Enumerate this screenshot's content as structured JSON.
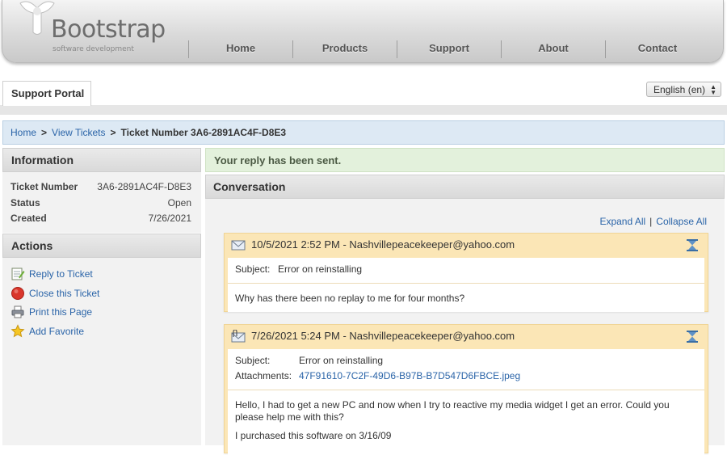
{
  "brand": {
    "name": "Bootstrap",
    "tagline": "software development"
  },
  "nav": [
    "Home",
    "Products",
    "Support",
    "About",
    "Contact"
  ],
  "portal": {
    "tab_label": "Support Portal",
    "language": "English (en)"
  },
  "breadcrumb": {
    "home": "Home",
    "view_tickets": "View Tickets",
    "current": "Ticket Number 3A6-2891AC4F-D8E3"
  },
  "information": {
    "title": "Information",
    "rows": [
      {
        "label": "Ticket Number",
        "value": "3A6-2891AC4F-D8E3"
      },
      {
        "label": "Status",
        "value": "Open"
      },
      {
        "label": "Created",
        "value": "7/26/2021"
      }
    ]
  },
  "actions": {
    "title": "Actions",
    "items": [
      {
        "label": "Reply to Ticket",
        "icon": "note-edit-icon"
      },
      {
        "label": "Close this Ticket",
        "icon": "red-circle-icon"
      },
      {
        "label": "Print this Page",
        "icon": "printer-icon"
      },
      {
        "label": "Add Favorite",
        "icon": "star-icon"
      }
    ]
  },
  "notice": "Your reply has been sent.",
  "conversation": {
    "title": "Conversation",
    "expand_all": "Expand All",
    "collapse_all": "Collapse All",
    "messages": [
      {
        "header": "10/5/2021 2:52 PM - Nashvillepeacekeeper@yahoo.com",
        "subject_label": "Subject:",
        "subject": "Error on reinstalling",
        "body": [
          "Why has there been no replay to me for four months?"
        ]
      },
      {
        "header": "7/26/2021 5:24 PM - Nashvillepeacekeeper@yahoo.com",
        "subject_label": "Subject:",
        "subject": "Error on reinstalling",
        "attachments_label": "Attachments:",
        "attachment": "47F91610-7C2F-49D6-B97B-B7D547D6FBCE.jpeg",
        "body": [
          "Hello, I had to get a new PC and now when I try to reactive my media widget I get an error. Could you please help me with this?",
          "I purchased this software on 3/16/09"
        ]
      }
    ]
  },
  "colors": {
    "link": "#2a64a8",
    "message_bg": "#fbe6b6",
    "notice_bg": "#e3f1dc",
    "breadcrumb_bg": "#dde9f4"
  }
}
